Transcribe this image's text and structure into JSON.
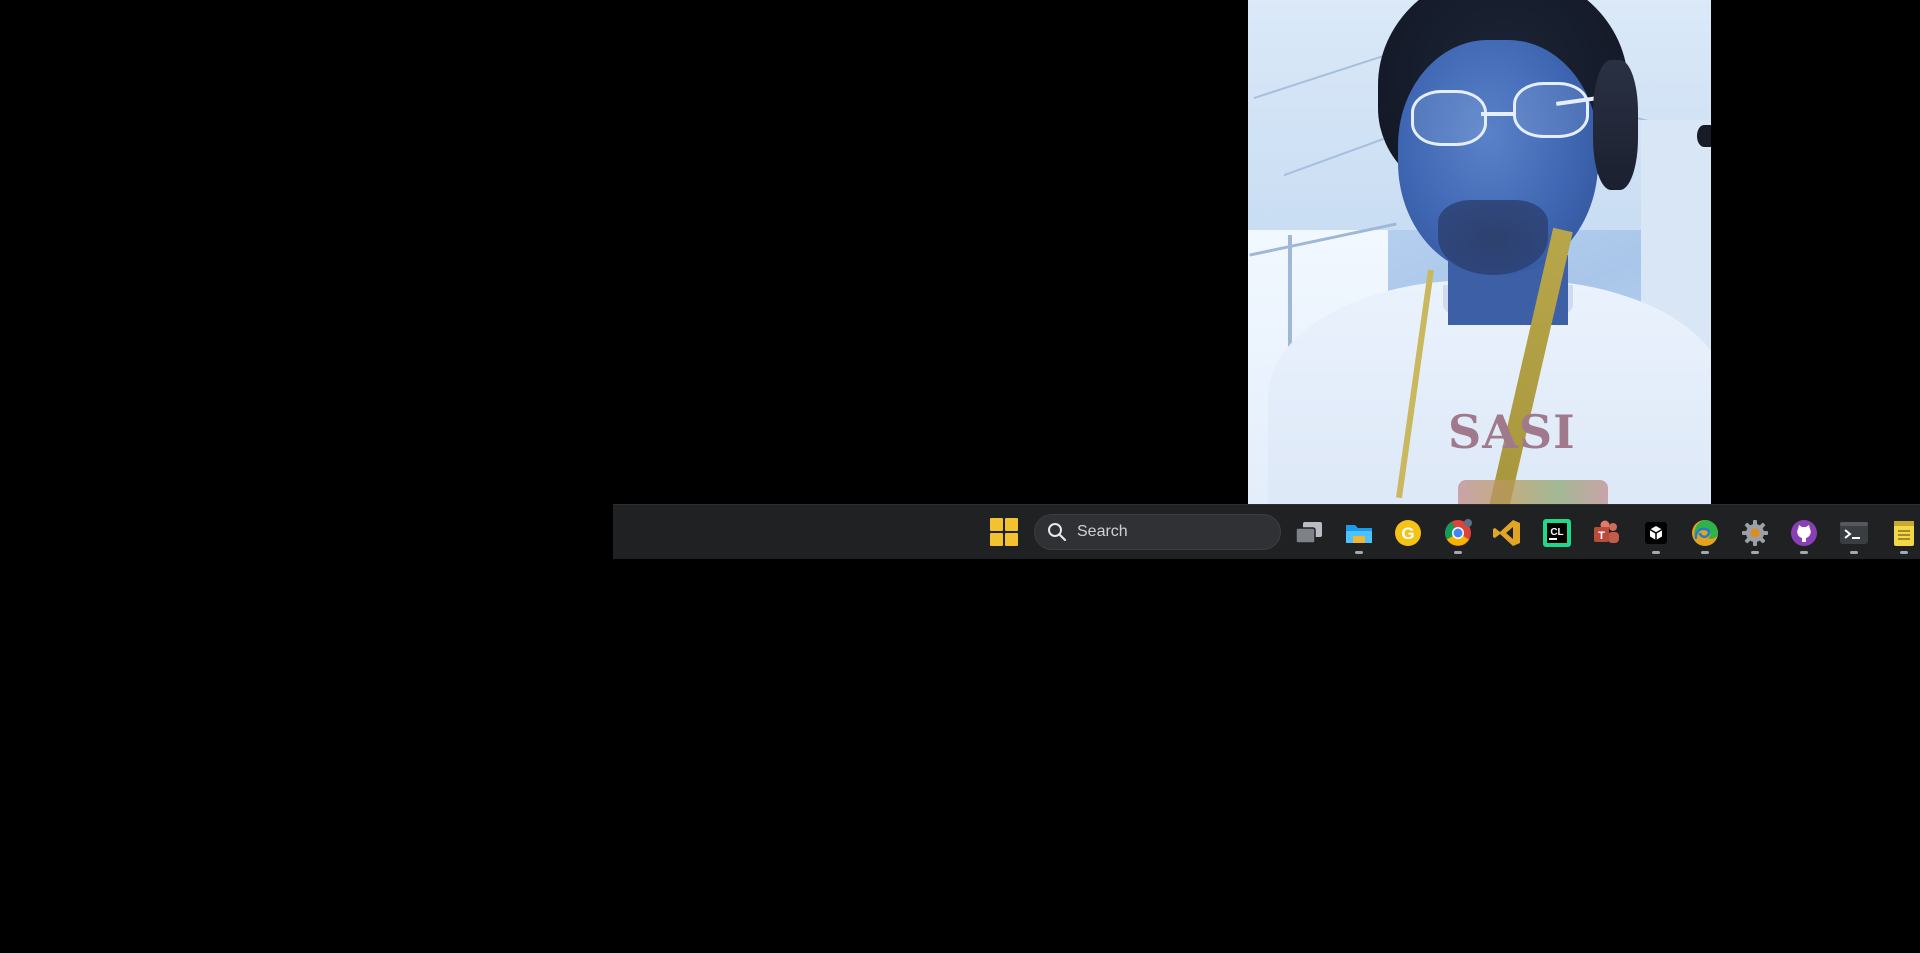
{
  "webcam": {
    "shirt_text": "SASI"
  },
  "taskbar": {
    "search": {
      "placeholder": "Search"
    },
    "icons": [
      {
        "name": "start-icon",
        "running": false
      },
      {
        "name": "task-view-icon",
        "running": false
      },
      {
        "name": "file-explorer-icon",
        "running": true
      },
      {
        "name": "g-app-icon",
        "running": false
      },
      {
        "name": "chrome-icon",
        "running": true
      },
      {
        "name": "visual-studio-icon",
        "running": false
      },
      {
        "name": "clion-icon",
        "running": false
      },
      {
        "name": "teams-icon",
        "running": false
      },
      {
        "name": "unity-icon",
        "running": true
      },
      {
        "name": "edge-icon",
        "running": true
      },
      {
        "name": "settings-gear-icon",
        "running": true
      },
      {
        "name": "github-desktop-icon",
        "running": true
      },
      {
        "name": "terminal-icon",
        "running": true
      },
      {
        "name": "notepad-icon",
        "running": true
      }
    ],
    "colors": {
      "background": "#202123",
      "start_accent": "#f3c22f"
    }
  }
}
